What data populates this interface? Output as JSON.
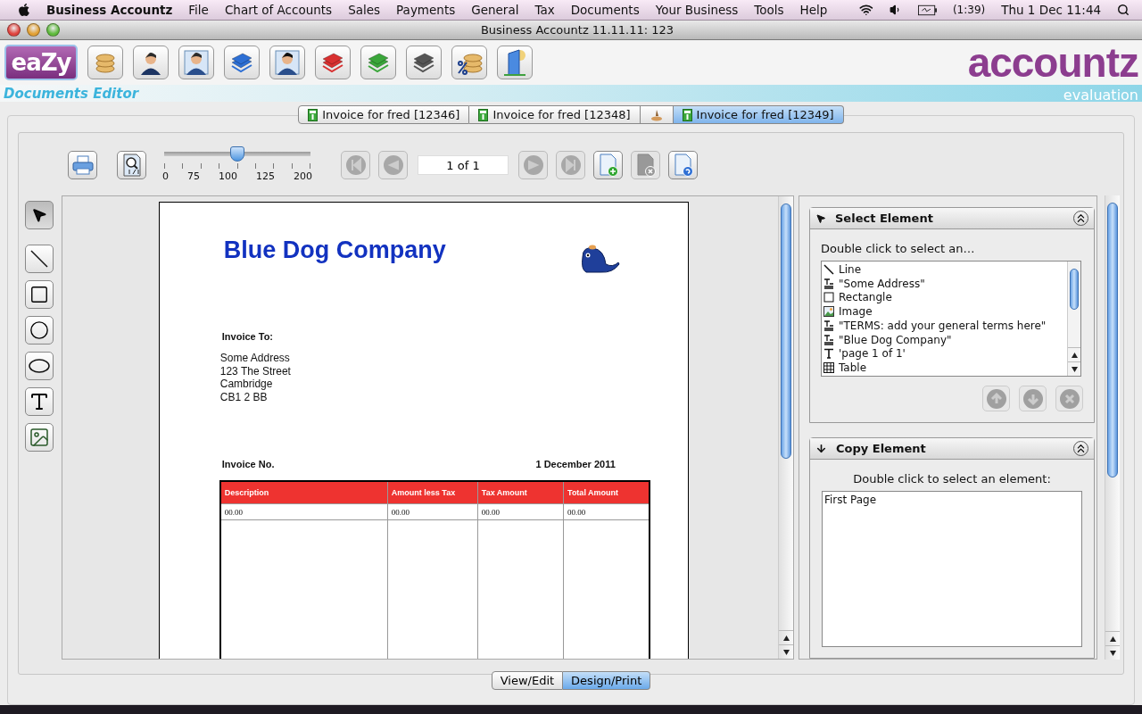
{
  "menu_bar": {
    "app_name": "Business Accountz",
    "items": [
      "File",
      "Chart of Accounts",
      "Sales",
      "Payments",
      "General",
      "Tax",
      "Documents",
      "Your Business",
      "Tools",
      "Help"
    ],
    "battery": "(1:39)",
    "clock": "Thu 1 Dec  11:44"
  },
  "window": {
    "title": "Business Accountz 11.11.11: 123"
  },
  "toolbar": {
    "home_button": "eaZy",
    "logo": "accountz"
  },
  "header": {
    "title": "Documents Editor",
    "edition": "evaluation"
  },
  "doc_tabs": [
    {
      "kind": "invoice",
      "label": "Invoice for fred [12346]",
      "selected": false
    },
    {
      "kind": "invoice",
      "label": "Invoice for fred [12348]",
      "selected": false
    },
    {
      "kind": "stamp",
      "selected": false
    },
    {
      "kind": "invoice",
      "label": "Invoice for fred [12349]",
      "selected": true
    }
  ],
  "zoom_slider": {
    "level": 0.5,
    "ticks": [
      "0",
      "75",
      "100",
      "125",
      "200"
    ]
  },
  "page_nav": {
    "back_buttons": [
      {
        "kind": "first",
        "disabled": true
      },
      {
        "kind": "previous",
        "disabled": true
      }
    ],
    "page_field": "1 of 1",
    "forward_buttons": [
      {
        "kind": "next",
        "disabled": true
      },
      {
        "kind": "last",
        "disabled": true
      }
    ]
  },
  "page_buttons": [
    {
      "kind": "add",
      "disabled": false
    },
    {
      "kind": "delete",
      "disabled": true
    },
    {
      "kind": "settings",
      "disabled": false
    }
  ],
  "tools": [
    {
      "kind": "pointer",
      "selected": true
    },
    {
      "kind": "line",
      "selected": false
    },
    {
      "kind": "rectangle",
      "selected": false
    },
    {
      "kind": "circle",
      "selected": false
    },
    {
      "kind": "ellipse",
      "selected": false
    },
    {
      "kind": "text",
      "selected": false
    },
    {
      "kind": "image",
      "selected": false
    }
  ],
  "document": {
    "company": "Blue Dog Company",
    "invoice_to_label": "Invoice To:",
    "address": [
      "Some Address",
      "123 The Street",
      "Cambridge",
      "CB1 2 BB"
    ],
    "invoice_no_label": "Invoice No.",
    "date": "1 December 2011",
    "table": {
      "columns": [
        "Description",
        "Amount less Tax",
        "Tax Amount",
        "Total Amount"
      ],
      "rows": [
        [
          "00.00",
          "00.00",
          "00.00",
          "00.00"
        ]
      ]
    }
  },
  "select_element": {
    "title": "Select Element",
    "hint": "Double click to select an…",
    "items": [
      {
        "kind": "line",
        "label": "Line"
      },
      {
        "kind": "text_field",
        "label": "\"Some Address\""
      },
      {
        "kind": "rectangle",
        "label": "Rectangle"
      },
      {
        "kind": "image",
        "label": "Image"
      },
      {
        "kind": "text_field",
        "label": "\"TERMS: add your general terms here\""
      },
      {
        "kind": "text_field",
        "label": "\"Blue Dog Company\""
      },
      {
        "kind": "text",
        "label": "'page 1 of 1'"
      },
      {
        "kind": "table",
        "label": "Table"
      }
    ],
    "buttons": [
      {
        "kind": "up",
        "disabled": true
      },
      {
        "kind": "down",
        "disabled": true
      },
      {
        "kind": "remove",
        "disabled": true
      }
    ]
  },
  "copy_element": {
    "title": "Copy Element",
    "hint": "Double click to select an element:",
    "items": [
      "First Page"
    ]
  },
  "mode_toggle": [
    {
      "label": "View/Edit",
      "selected": false
    },
    {
      "label": "Design/Print",
      "selected": true
    }
  ]
}
